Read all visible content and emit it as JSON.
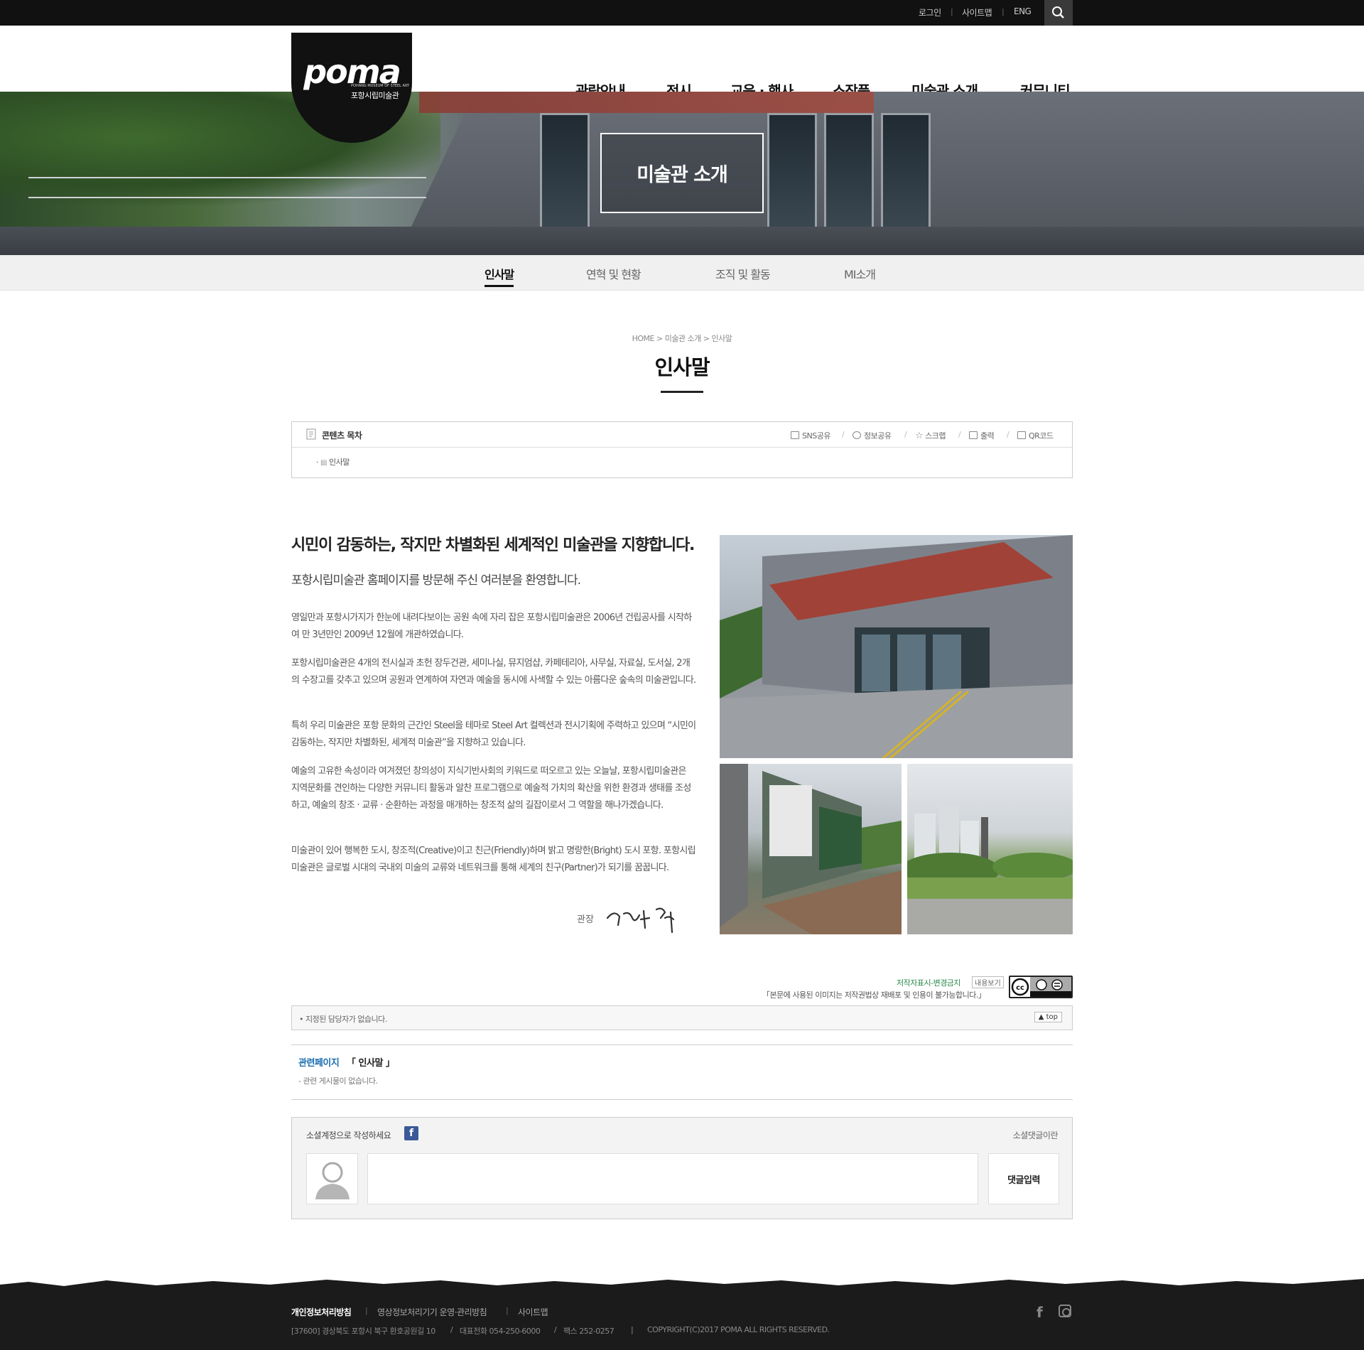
{
  "topbar": {
    "login": "로그인",
    "sitemap": "사이트맵",
    "eng": "ENG",
    "sep": "|"
  },
  "logo": {
    "wordmark": "poma",
    "sub": "포항시립미술관",
    "tiny": "POHANG MUSEUM OF STEEL ART"
  },
  "gnb": [
    "관람안내",
    "전시",
    "교육 · 행사",
    "소장품",
    "미술관 소개",
    "커뮤니티"
  ],
  "hero": {
    "title": "미술관 소개"
  },
  "subnav": [
    "인사말",
    "연혁 및 현황",
    "조직 및 활동",
    "MI소개"
  ],
  "breadcrumb": "HOME > 미술관 소개 > 인사말",
  "page_title": "인사말",
  "toc": {
    "title": "콘텐츠 목차",
    "item": "인사말",
    "tools": [
      "SNS공유",
      "정보공유",
      "스크랩",
      "출력",
      "QR코드"
    ]
  },
  "greeting": {
    "heading": "시민이 감동하는, 작지만 차별화된 세계적인 미술관을 지향합니다.",
    "sub": "포항시립미술관 홈페이지를 방문해 주신 여러분을 환영합니다.",
    "paragraphs": [
      "영일만과 포항시가지가 한눈에 내려다보이는 공원 속에 자리 잡은 포항시립미술관은 2006년 건립공사를 시작하여 만 3년만인 2009년 12월에 개관하였습니다.",
      "포항시립미술관은 4개의 전시실과 초헌 장두건관, 세미나실, 뮤지엄샵, 카페테리아, 사무실, 자료실, 도서실, 2개의 수장고를 갖추고 있으며 공원과 연계하여 자연과 예술을 동시에 사색할 수 있는 아름다운 숲속의 미술관입니다.",
      "특히 우리 미술관은 포항 문화의 근간인 Steel을 테마로 Steel Art 컬렉션과 전시기획에 주력하고 있으며 “시민이 감동하는, 작지만 차별화된, 세계적 미술관”을 지향하고 있습니다.",
      "예술의 고유한 속성이라 여겨졌던 창의성이 지식기반사회의 키워드로 떠오르고 있는 오늘날, 포항시립미술관은 지역문화를 견인하는 다양한 커뮤니티 활동과 알찬 프로그램으로 예술적 가치의 확산을 위한 환경과 생태를 조성하고, 예술의 창조 · 교류 · 순환하는 과정을 매개하는 창조적 삶의 길잡이로서 그 역할을 해나가겠습니다.",
      "미술관이 있어 행복한 도시, 창조적(Creative)이고 친근(Friendly)하며 밝고 명랑한(Bright) 도시 포항. 포항시립미술관은 글로벌 시대의 국내외 미술의 교류와 네트워크를 통해 세계의 친구(Partner)가 되기를 꿈꿉니다."
    ],
    "sig_label": "관장"
  },
  "license": {
    "link": "저작자표시-변경금지",
    "view": "내용보기",
    "note": "「본문에 사용된 이미지는 저작권법상 재배포 및 인용이 불가능합니다.」",
    "badge": "cc BY ND"
  },
  "manager": {
    "text": "• 지정된 담당자가 없습니다.",
    "top": "▲ top"
  },
  "related": {
    "label": "관련페이지",
    "page": "「 인사말 」",
    "none": "- 관련 게시물이 없습니다."
  },
  "social": {
    "label": "소셜계정으로 작성하세요",
    "fb": "f",
    "about": "소셜댓글이란",
    "placeholder": "",
    "button": "댓글입력"
  },
  "footer": {
    "links": [
      "개인정보처리방침",
      "영상정보처리기기 운영·관리방침",
      "사이트맵"
    ],
    "address": "[37600] 경상북도 포항시 북구 환호공원길 10",
    "tel": "대표전화 054-250-6000",
    "fax": "팩스 252-0257",
    "copyright": "COPYRIGHT(C)2017 POMA ALL RIGHTS RESERVED.",
    "sep": "|",
    "slash": "/",
    "fb": "f"
  },
  "colors": {
    "topbar": "#111111",
    "accent_link": "#1a6fb0",
    "license_green": "#2a8a4a",
    "facebook": "#3b5998",
    "footer": "#1b1b1b"
  }
}
